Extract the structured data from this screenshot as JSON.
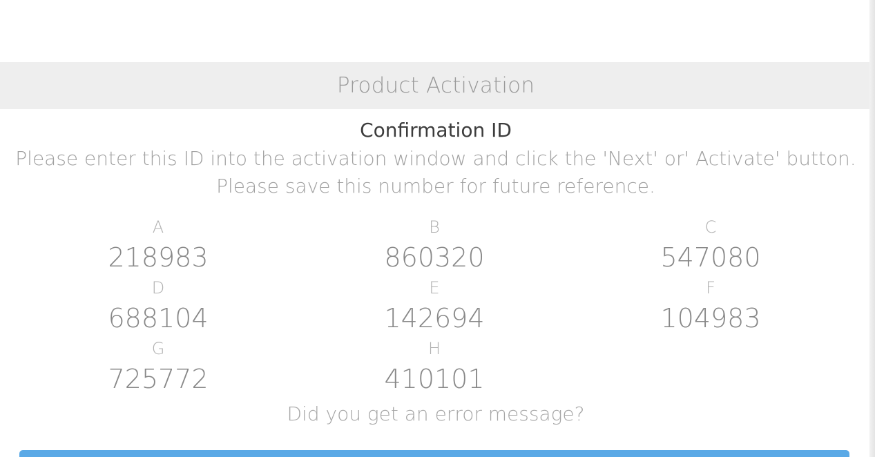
{
  "header": {
    "title": "Product Activation"
  },
  "confirmation": {
    "heading": "Confirmation ID",
    "instruction_line1": "Please enter this ID into the activation window and click the 'Next' or' Activate' button.",
    "instruction_line2": "Please save this number for future reference."
  },
  "id_groups": [
    {
      "letter": "A",
      "code": "218983"
    },
    {
      "letter": "B",
      "code": "860320"
    },
    {
      "letter": "C",
      "code": "547080"
    },
    {
      "letter": "D",
      "code": "688104"
    },
    {
      "letter": "E",
      "code": "142694"
    },
    {
      "letter": "F",
      "code": "104983"
    },
    {
      "letter": "G",
      "code": "725772"
    },
    {
      "letter": "H",
      "code": "410101"
    }
  ],
  "error_prompt": "Did you get an error message?",
  "colors": {
    "header_bg": "#eeeeee",
    "button_blue": "#5aa9e6"
  }
}
